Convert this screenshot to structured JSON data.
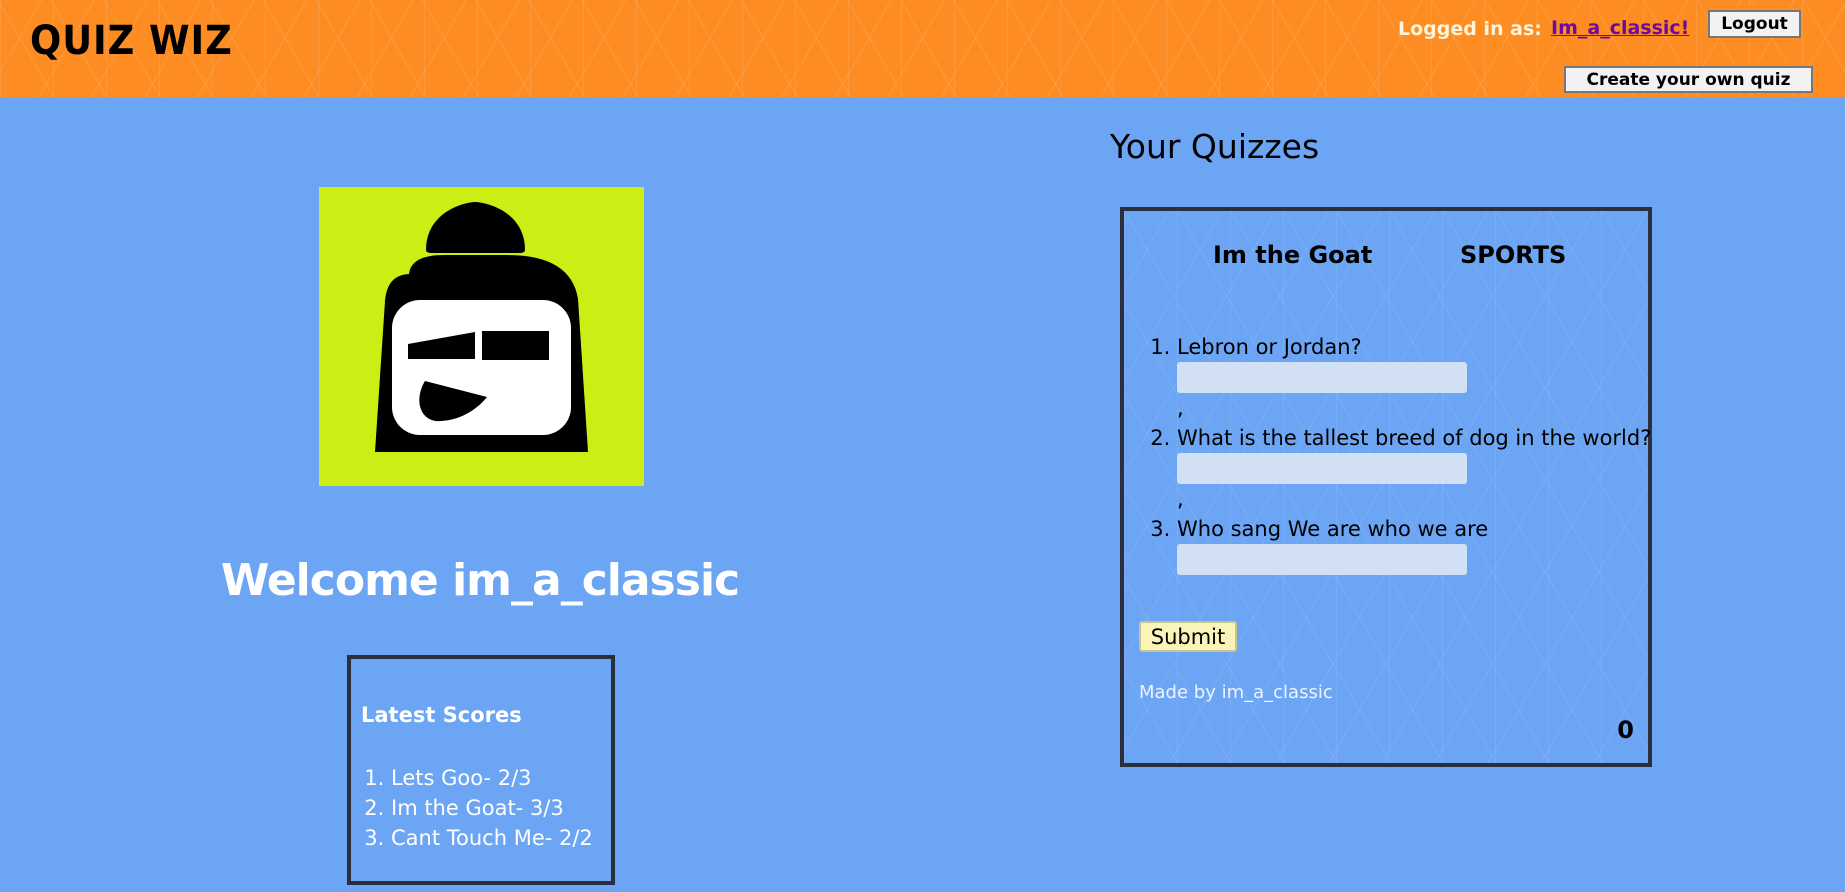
{
  "header": {
    "logo": "QUIZ WIZ",
    "logged_in_label": "Logged in as:",
    "username_link": "Im_a_classic!",
    "logout_label": "Logout",
    "create_label": "Create your own quiz",
    "background_color": "#fd8d22"
  },
  "profile": {
    "avatar_icon": "bun-face-avatar-icon",
    "avatar_background": "#cbef15",
    "welcome": "Welcome im_a_classic",
    "latest_scores_title": "Latest Scores",
    "latest_scores": [
      "Lets Goo- 2/3",
      "Im the Goat- 3/3",
      "Cant Touch Me- 2/2"
    ]
  },
  "quizzes": {
    "title": "Your Quizzes",
    "items": [
      {
        "name": "Im the Goat",
        "category": "SPORTS",
        "questions": [
          "Lebron or Jordan?",
          "What is the tallest breed of dog in the world?",
          "Who sang We are who we are"
        ],
        "separator": ",",
        "submit_label": "Submit",
        "made_by": "Made by im_a_classic",
        "count": "0"
      }
    ]
  },
  "colors": {
    "page_background": "#6ca5f4",
    "submit_background": "#fbf4b8"
  }
}
